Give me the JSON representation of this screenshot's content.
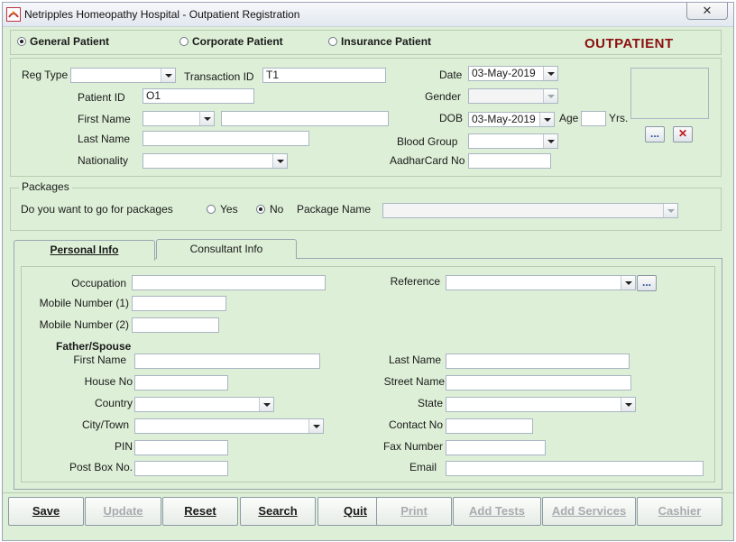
{
  "window": {
    "title": "Netripples Homeopathy Hospital - Outpatient Registration",
    "close_label": "✕"
  },
  "patient_type": {
    "options": [
      {
        "label": "General Patient",
        "selected": true
      },
      {
        "label": "Corporate Patient",
        "selected": false
      },
      {
        "label": "Insurance Patient",
        "selected": false
      }
    ],
    "header_label": "OUTPATIENT"
  },
  "registration": {
    "reg_type_label": "Reg Type",
    "reg_type_value": "",
    "transaction_id_label": "Transaction ID",
    "transaction_id_value": "T1",
    "patient_id_label": "Patient ID",
    "patient_id_value": "O1",
    "first_name_label": "First Name",
    "title_value": "",
    "first_name_value": "",
    "last_name_label": "Last Name",
    "last_name_value": "",
    "nationality_label": "Nationality",
    "nationality_value": "",
    "date_label": "Date",
    "date_value": "03-May-2019",
    "gender_label": "Gender",
    "gender_value": "",
    "dob_label": "DOB",
    "dob_value": "03-May-2019",
    "age_label": "Age",
    "age_value": "",
    "yrs_label": "Yrs.",
    "blood_group_label": "Blood Group",
    "blood_group_value": "",
    "aadhar_label": "AadharCard No",
    "aadhar_value": "",
    "browse_photo_label": "...",
    "clear_photo_label": "✕"
  },
  "packages": {
    "legend": "Packages",
    "question": "Do you want to go for packages",
    "yes_label": "Yes",
    "yes_selected": false,
    "no_label": "No",
    "no_selected": true,
    "package_name_label": "Package Name",
    "package_name_value": ""
  },
  "tabs": [
    {
      "label": "Personal Info",
      "active": true
    },
    {
      "label": "Consultant Info",
      "active": false
    }
  ],
  "personal": {
    "occupation_label": "Occupation",
    "occupation_value": "",
    "mobile1_label": "Mobile Number (1)",
    "mobile1_value": "",
    "mobile2_label": "Mobile Number (2)",
    "mobile2_value": "",
    "reference_label": "Reference",
    "reference_value": "",
    "reference_browse": "...",
    "father_spouse_heading": "Father/Spouse",
    "first_name_label": "First Name",
    "first_name_value": "",
    "house_no_label": "House No",
    "house_no_value": "",
    "country_label": "Country",
    "country_value": "",
    "city_label": "City/Town",
    "city_value": "",
    "pin_label": "PIN",
    "pin_value": "",
    "post_box_label": "Post Box No.",
    "post_box_value": "",
    "last_name_label": "Last Name",
    "last_name_value": "",
    "street_label": "Street Name",
    "street_value": "",
    "state_label": "State",
    "state_value": "",
    "contact_label": "Contact No",
    "contact_value": "",
    "fax_label": "Fax Number",
    "fax_value": "",
    "email_label": "Email",
    "email_value": ""
  },
  "buttons": {
    "save": "Save",
    "update": "Update",
    "reset": "Reset",
    "search": "Search",
    "quit": "Quit",
    "print": "Print",
    "add_tests": "Add Tests",
    "add_services": "Add Services",
    "cashier": "Cashier"
  }
}
